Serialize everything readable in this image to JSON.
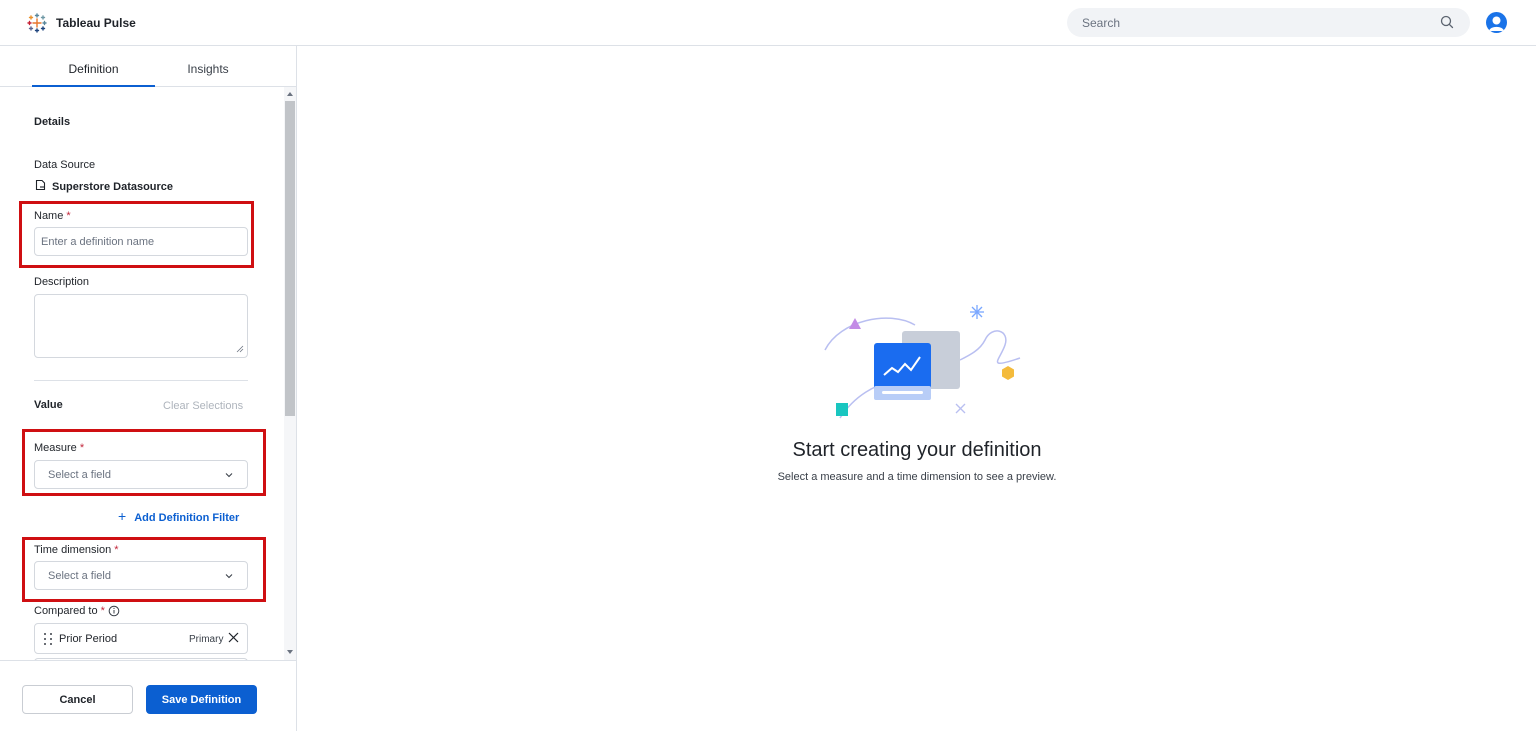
{
  "header": {
    "app_title": "Tableau Pulse",
    "search_placeholder": "Search"
  },
  "tabs": [
    {
      "label": "Definition",
      "active": true
    },
    {
      "label": "Insights",
      "active": false
    }
  ],
  "details": {
    "section_title": "Details",
    "data_source_label": "Data Source",
    "data_source_value": "Superstore Datasource",
    "name_label": "Name",
    "required_mark": "*",
    "name_placeholder": "Enter a definition name",
    "description_label": "Description"
  },
  "value": {
    "section_title": "Value",
    "clear_selections": "Clear Selections",
    "measure_label": "Measure",
    "measure_placeholder": "Select a field",
    "add_filter": "Add Definition Filter",
    "time_dimension_label": "Time dimension",
    "time_dimension_placeholder": "Select a field",
    "compared_to_label": "Compared to",
    "compared_items": [
      {
        "label": "Prior Period",
        "badge": "Primary"
      }
    ]
  },
  "footer": {
    "cancel": "Cancel",
    "save": "Save Definition"
  },
  "empty_state": {
    "title": "Start creating your definition",
    "subtitle": "Select a measure and a time dimension to see a preview."
  },
  "colors": {
    "accent": "#0b5fd1",
    "highlight": "#cf0f12",
    "required": "#c2263a"
  },
  "icons": [
    "tableau-logo-icon",
    "search-icon",
    "user-avatar-icon",
    "datasource-icon",
    "chevron-down-icon",
    "info-icon",
    "drag-handle-icon",
    "close-icon",
    "plus-icon"
  ]
}
